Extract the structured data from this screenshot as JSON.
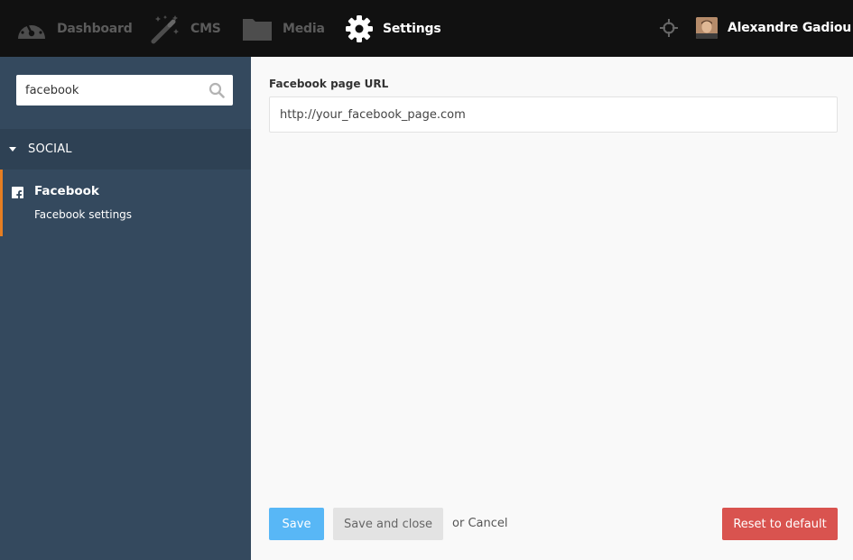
{
  "topbar": {
    "nav": [
      {
        "label": "Dashboard",
        "icon": "dashboard-gauge-icon",
        "active": false
      },
      {
        "label": "CMS",
        "icon": "magic-wand-icon",
        "active": false
      },
      {
        "label": "Media",
        "icon": "folder-icon",
        "active": false
      },
      {
        "label": "Settings",
        "icon": "gear-icon",
        "active": true
      }
    ],
    "user": {
      "name": "Alexandre Gadiou",
      "avatar": "user-avatar"
    },
    "crosshair_icon": "crosshair-icon"
  },
  "sidebar": {
    "search": {
      "value": "facebook",
      "placeholder": "",
      "icon": "search-icon"
    },
    "section": {
      "label": "SOCIAL",
      "expanded": true
    },
    "items": [
      {
        "title": "Facebook",
        "subtitle": "Facebook settings",
        "icon": "facebook-icon",
        "selected": true
      }
    ]
  },
  "main": {
    "field": {
      "label": "Facebook page URL",
      "value": "http://your_facebook_page.com"
    },
    "actions": {
      "save": "Save",
      "save_close": "Save and close",
      "or": "or",
      "cancel": "Cancel",
      "reset": "Reset to default"
    }
  },
  "colors": {
    "topbar_bg": "#111111",
    "sidebar_bg": "#34495e",
    "section_bg": "#2e4154",
    "selected_accent": "#e67e22",
    "save_btn": "#58b7f6",
    "reset_btn": "#d9534f"
  }
}
